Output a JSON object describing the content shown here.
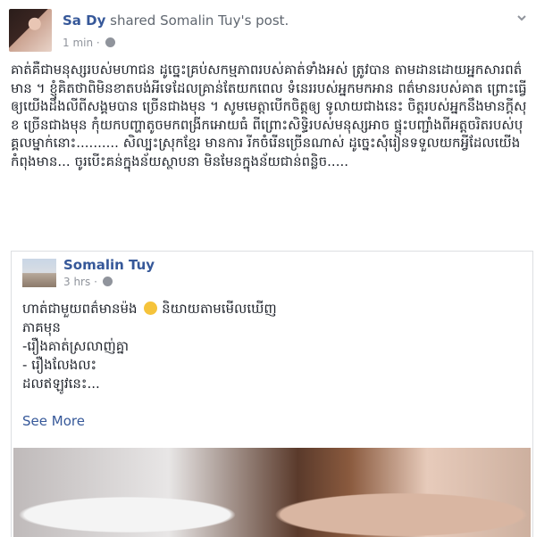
{
  "post": {
    "author": "Sa Dy",
    "action": "shared",
    "shared_from": "Somalin Tuy's post.",
    "time": "1 min",
    "privacy_icon": "globe-icon",
    "menu_icon": "chevron-down-icon",
    "body": "គាត់គឺជាមនុស្សរបស់មហាជន ដូច្នេះគ្រប់សកម្មភាពរបស់គាត់ទាំងអស់ ត្រូវបាន តាមដានដោយអ្នកសារពត៌មាន ។ ខ្ញុំគិតថាពិមិនខាតបង់អីទេដែលគ្រាន់តែយកពេល ទំនេររបស់អ្នកមកអាន ពត៌មានរបស់គាត ព្រោះធ្វើឲ្យយើងដឹងលីពីសង្គមបាន ច្រើនជាងមុន ។ សូមមេត្ដាបើកចិត្តឲ្យ ទូលាយជាងនេះ ចិត្តរបស់អ្នកនឹងមានក្ដីសុខ ច្រើនជាងមុន កុំយកបញ្ហាតូចមកពង្រីកអោយធំ ពីព្រោះសិទ្ធិរបស់មនុស្សអាច ផ្ទុះបញ្ជាំងពីអត្តចរិតរបស់បុគ្គលម្នាក់នោះ.......... សិល្បះស្រុកខ្មែរ មានការ រីកចំរើនច្រើនណាស់ ដូច្នេះសុំរៀនទទួលយកអ្វីដែលយើងកំពុងមាន... ចូរបើះគន់ក្នុងន័យស្ថាបនា មិនមែនក្នុងន័យជាន់ពន្លិច....."
  },
  "shared_post": {
    "author": "Somalin Tuy",
    "time": "3 hrs",
    "privacy_icon": "globe-icon",
    "lines": [
      "ហាត់ជាមួយពត៌មានម៉ង",
      "និយាយតាមមើលឃើញ",
      "ភាគមុន",
      "-រឿងគាត់ស្រលាញ់គ្នា",
      "- រឿងលែងលះ",
      "ដលឥឡូវនេះ..."
    ],
    "emoji_icon": "pensive-face-emoji",
    "see_more": "See More"
  },
  "colors": {
    "link": "#365899",
    "meta": "#90949c",
    "text": "#1d2129",
    "border": "#dddfe2"
  }
}
